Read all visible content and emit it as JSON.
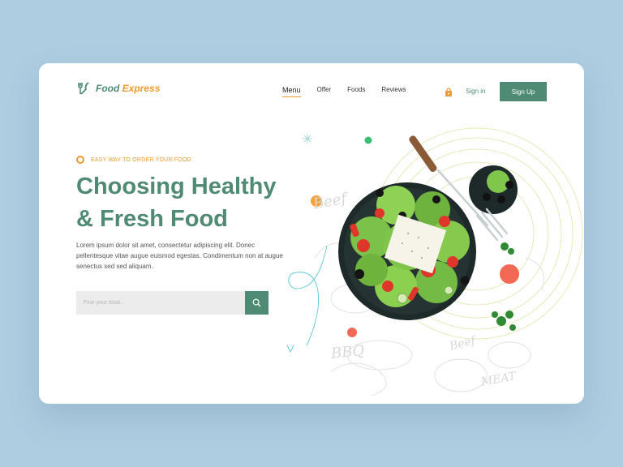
{
  "brand": {
    "name_part1": "Food",
    "name_part2": "Express"
  },
  "nav": {
    "items": [
      {
        "label": "Menu",
        "active": true
      },
      {
        "label": "Offer",
        "active": false
      },
      {
        "label": "Foods",
        "active": false
      },
      {
        "label": "Reviews",
        "active": false
      }
    ]
  },
  "header": {
    "signin_label": "Sign in",
    "signup_label": "Sign Up",
    "cart_icon": "shopping-bag-icon"
  },
  "hero": {
    "tagline": "EASY WAY TO ORDER YOUR FOOD",
    "headline_line1": "Choosing Healthy",
    "headline_line2": "& Fresh Food",
    "paragraph": "Lorem ipsum dolor sit amet, consectetur adipiscing elit. Donec pellentesque vitae augue euismod egestas. Condimentum non at augue senectus sed sed aliquam."
  },
  "search": {
    "placeholder": "Fine your food...",
    "icon": "search-icon"
  },
  "sketch_words": [
    "Beef",
    "BBQ",
    "Beef",
    "MEAT"
  ],
  "colors": {
    "primary": "#4f8a74",
    "accent": "#ef9a2c",
    "coral": "#f26a55",
    "background": "#aecde1"
  }
}
